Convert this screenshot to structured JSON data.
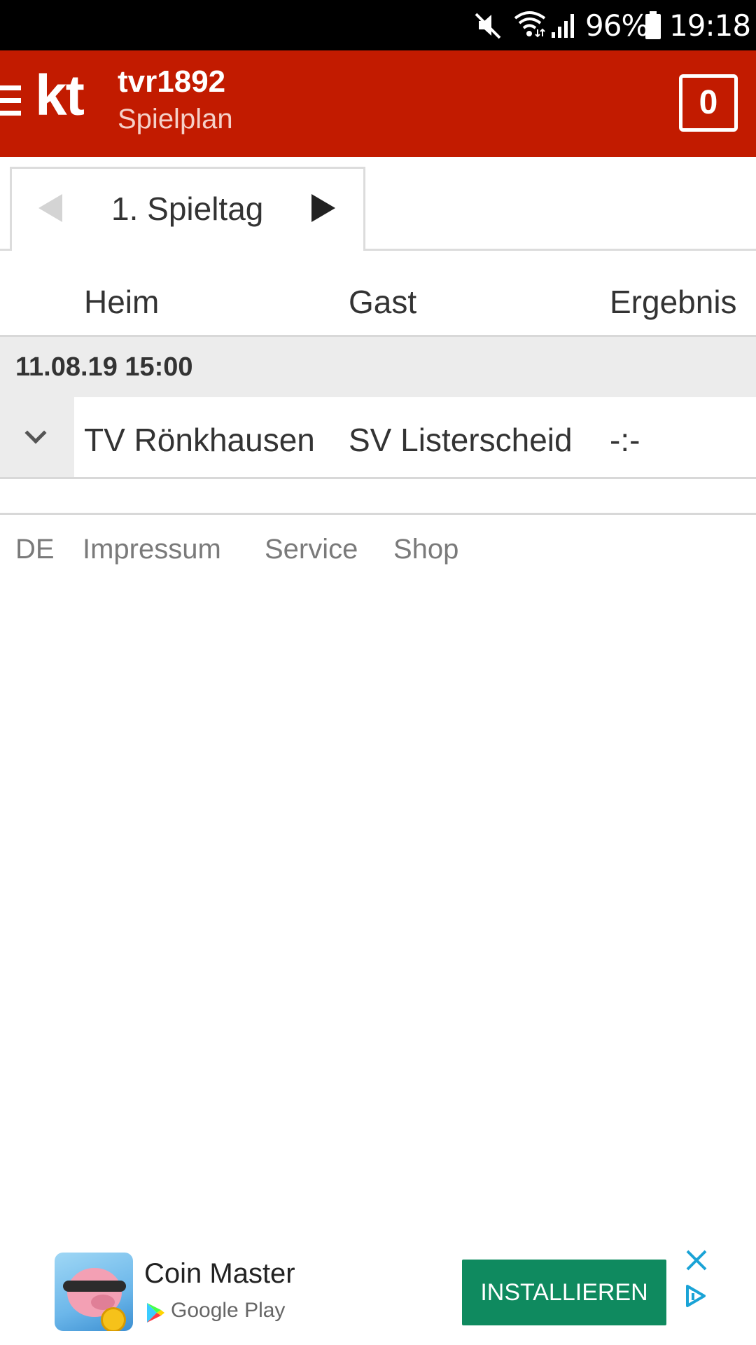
{
  "status_bar": {
    "battery_percent": "96%",
    "time": "19:18",
    "icons": [
      "mute-icon",
      "wifi-icon",
      "signal-icon",
      "battery-icon"
    ]
  },
  "header": {
    "logo": "kt",
    "club": "tvr1892",
    "subtitle": "Spielplan",
    "cart_count": "0",
    "color": "#c21b00"
  },
  "matchday": {
    "label": "1. Spieltag"
  },
  "table": {
    "columns": [
      "Heim",
      "Gast",
      "Ergebnis"
    ],
    "groups": [
      {
        "date": "11.08.19 15:00",
        "matches": [
          {
            "home": "TV Rönkhausen",
            "away": "SV Listerscheid",
            "result": "-:-"
          }
        ]
      }
    ]
  },
  "footer": {
    "links": [
      "DE",
      "Impressum",
      "Service",
      "Shop"
    ]
  },
  "ad": {
    "app_name": "Coin Master",
    "store": "Google Play",
    "cta": "INSTALLIEREN",
    "cta_color": "#0f8a5f",
    "accent": "#1aa3d6"
  }
}
